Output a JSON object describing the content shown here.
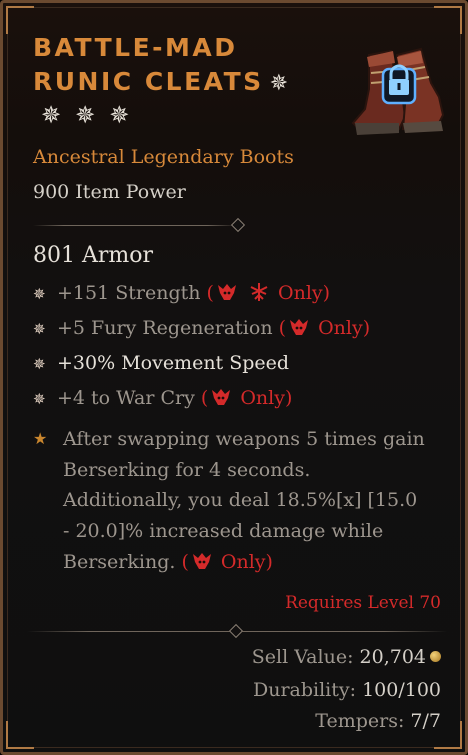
{
  "item": {
    "name_line1": "Battle-Mad",
    "name_line2": "Runic Cleats",
    "rarity": "Ancestral Legendary Boots",
    "item_power": "900 Item Power",
    "armor": "801 Armor",
    "image_icon": "boots-with-lock-icon"
  },
  "affixes": [
    {
      "text": "+151 Strength",
      "only": "Only",
      "class_icons": [
        "barbarian-icon",
        "necromancer-icon"
      ]
    },
    {
      "text": "+5 Fury Regeneration",
      "only": "Only",
      "class_icons": [
        "barbarian-icon"
      ]
    },
    {
      "text": "+30% Movement Speed"
    },
    {
      "text": "+4 to War Cry",
      "only": "Only",
      "class_icons": [
        "barbarian-icon"
      ]
    }
  ],
  "aspect": {
    "line1": "After swapping weapons 5 times gain",
    "line2": "Berserking for 4 seconds.",
    "line3": "Additionally, you deal 18.5%[x] [15.0",
    "line4": "- 20.0]% increased damage while",
    "line5": "Berserking.",
    "only": "Only",
    "class_icons": [
      "barbarian-icon"
    ]
  },
  "requirements": "Requires Level 70",
  "footer": {
    "sell_label": "Sell Value:",
    "sell_value": "20,704",
    "durability_label": "Durability:",
    "durability_value": "100/100",
    "tempers_label": "Tempers:",
    "tempers_value": "7/7"
  },
  "colors": {
    "title": "#d8893a",
    "class_only": "#d42a2a",
    "aspect_bullet": "#c9862e"
  }
}
